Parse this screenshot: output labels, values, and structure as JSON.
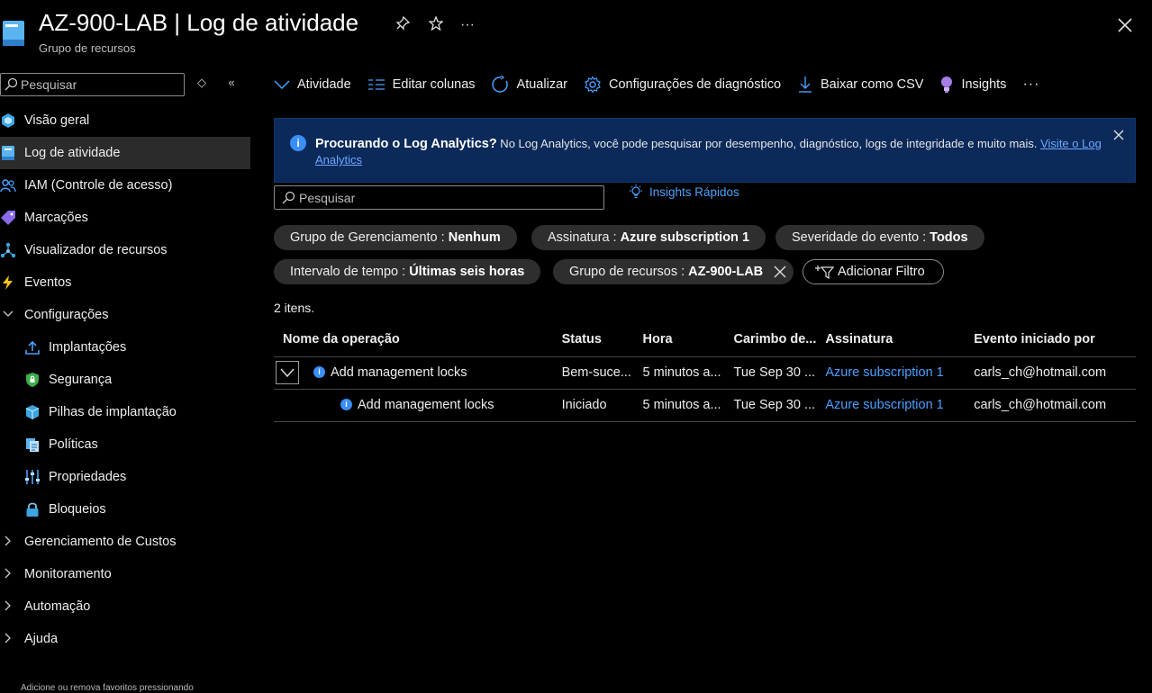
{
  "header": {
    "title": "AZ-900-LAB | Log de atividade",
    "subtitle": "Grupo de recursos"
  },
  "sidebar": {
    "search_placeholder": "Pesquisar",
    "items": [
      {
        "label": "Visão geral",
        "icon": "overview-cube-icon"
      },
      {
        "label": "Log de atividade",
        "icon": "activity-log-icon",
        "active": true
      },
      {
        "label": "IAM (Controle de acesso)",
        "icon": "people-icon"
      },
      {
        "label": "Marcações",
        "icon": "tag-icon"
      },
      {
        "label": "Visualizador de recursos",
        "icon": "resource-visualizer-icon"
      },
      {
        "label": "Eventos",
        "icon": "lightning-icon"
      }
    ],
    "config_group": {
      "label": "Configurações"
    },
    "config_items": [
      {
        "label": "Implantações",
        "icon": "upload-icon"
      },
      {
        "label": "Segurança",
        "icon": "shield-icon"
      },
      {
        "label": "Pilhas de implantação",
        "icon": "deployment-stack-icon"
      },
      {
        "label": "Políticas",
        "icon": "policy-document-icon"
      },
      {
        "label": "Propriedades",
        "icon": "properties-bars-icon"
      },
      {
        "label": "Bloqueios",
        "icon": "lock-icon"
      }
    ],
    "groups": [
      {
        "label": "Gerenciamento de Custos"
      },
      {
        "label": "Monitoramento"
      },
      {
        "label": "Automação"
      },
      {
        "label": "Ajuda"
      }
    ],
    "footer": "Adicione ou remova favoritos pressionando"
  },
  "toolbar": {
    "activity": "Atividade",
    "edit_columns": "Editar colunas",
    "refresh": "Atualizar",
    "diagnostic": "Configurações de diagnóstico",
    "download": "Baixar como CSV",
    "insights": "Insights",
    "more": "···"
  },
  "banner": {
    "title": "Procurando o Log Analytics?",
    "text": " No Log Analytics, você pode pesquisar por desempenho, diagnóstico, logs de integridade e muito mais. ",
    "link": "Visite o Log Analytics"
  },
  "search": {
    "placeholder": "Pesquisar",
    "quick_insights": "Insights Rápidos"
  },
  "filters": [
    {
      "key": "Grupo de Gerenciamento : ",
      "value": "Nenhum"
    },
    {
      "key": "Assinatura : ",
      "value": "Azure subscription 1"
    },
    {
      "key": "Severidade do evento : ",
      "value": "Todos"
    },
    {
      "key": "Intervalo de tempo : ",
      "value": "Últimas seis horas"
    },
    {
      "key": "Grupo de recursos : ",
      "value": "AZ-900-LAB"
    }
  ],
  "add_filter": "Adicionar Filtro",
  "count": "2 itens.",
  "table": {
    "columns": [
      "Nome da operação",
      "Status",
      "Hora",
      "Carimbo de...",
      "Assinatura",
      "Evento iniciado por"
    ],
    "rows": [
      {
        "operation": "Add management locks",
        "status": "Bem-suce...",
        "time": "5 minutos a...",
        "timestamp": "Tue Sep 30 ...",
        "subscription": "Azure subscription 1",
        "caller": "carls_ch@hotmail.com"
      },
      {
        "operation": "Add management locks",
        "status": "Iniciado",
        "time": "5 minutos a...",
        "timestamp": "Tue Sep 30 ...",
        "subscription": "Azure subscription 1",
        "caller": "carls_ch@hotmail.com"
      }
    ]
  },
  "colors": {
    "accent": "#4aa0ff",
    "banner_bg": "#0b2a5a",
    "active_nav": "#2b2b2b",
    "pill_bg": "#2e2e2e"
  }
}
